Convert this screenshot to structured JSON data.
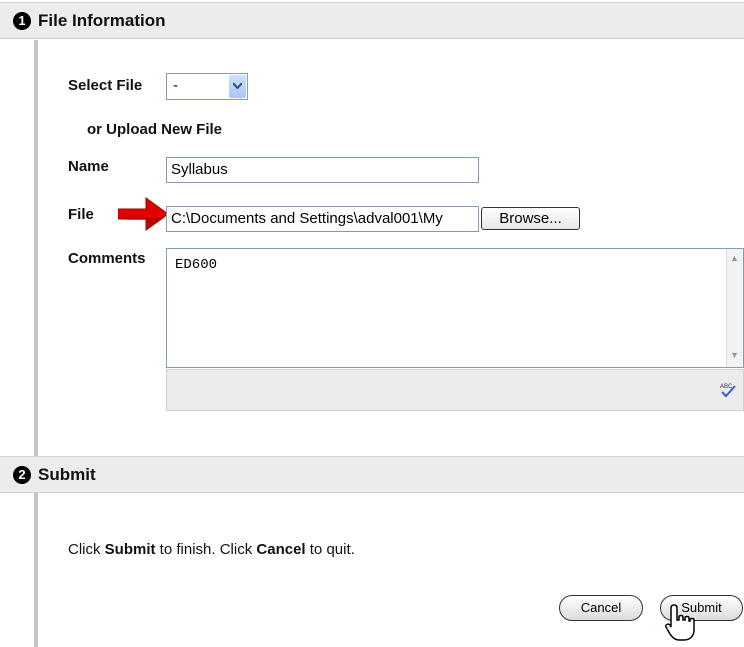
{
  "file_information": {
    "step": "1",
    "title": "File Information",
    "select_file": {
      "label": "Select File",
      "value": "-"
    },
    "upload_new_label": "or Upload New File",
    "name": {
      "label": "Name",
      "value": "Syllabus"
    },
    "file": {
      "label": "File",
      "value": "C:\\Documents and Settings\\adval001\\My",
      "browse_label": "Browse..."
    },
    "comments": {
      "label": "Comments",
      "value": "ED600"
    }
  },
  "submit_section": {
    "step": "2",
    "title": "Submit",
    "instructions": {
      "part1": "Click ",
      "submit_word": "Submit",
      "part2": " to finish. Click ",
      "cancel_word": "Cancel",
      "part3": " to quit."
    },
    "cancel_label": "Cancel",
    "submit_label": "Submit"
  },
  "icons": {
    "arrow": "red-arrow-icon",
    "spellcheck": "spellcheck-icon",
    "cursor": "hand-cursor-icon"
  },
  "colors": {
    "header_bg": "#ececec",
    "arrow_red": "#e00000",
    "input_border": "#7f9db9"
  }
}
